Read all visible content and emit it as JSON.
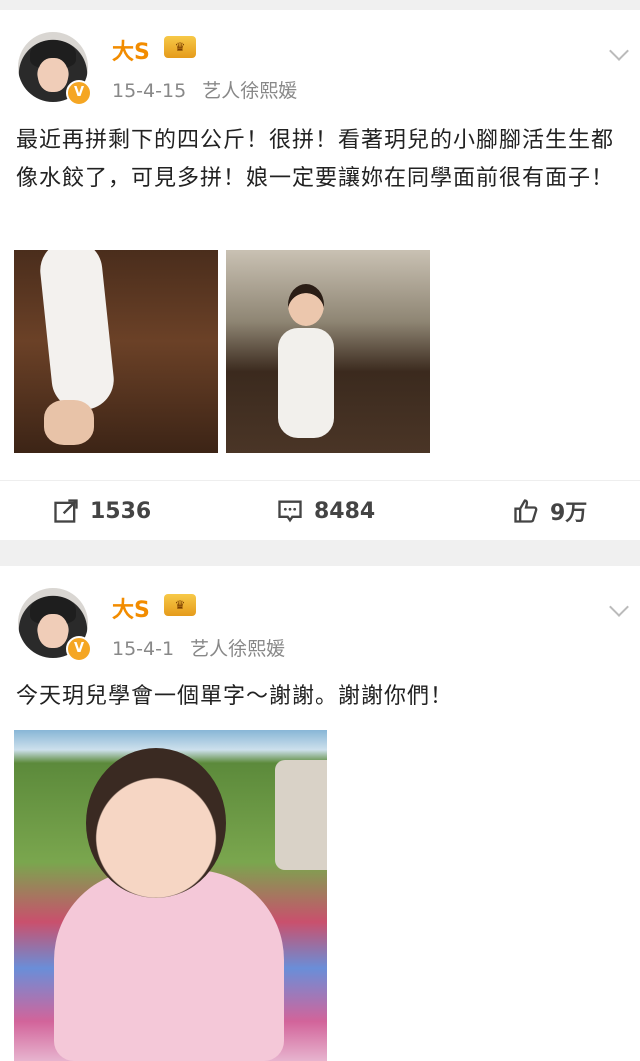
{
  "posts": [
    {
      "author": "大S",
      "verified_badge": "V",
      "crown_badge": "crown-icon",
      "date": "15-4-15",
      "source": "艺人徐熙媛",
      "text": "最近再拼剩下的四公斤！很拼！看著玥兒的小腳腳活生生都像水餃了，可見多拼！娘一定要讓妳在同學面前很有面子！",
      "stats": {
        "repost": "1536",
        "comment": "8484",
        "like": "9万"
      }
    },
    {
      "author": "大S",
      "verified_badge": "V",
      "crown_badge": "crown-icon",
      "date": "15-4-1",
      "source": "艺人徐熙媛",
      "text": "今天玥兒學會一個單字～謝謝。謝謝你們！"
    }
  ],
  "colors": {
    "name": "#f28c00",
    "meta": "#888888",
    "badge": "#f5a623"
  }
}
